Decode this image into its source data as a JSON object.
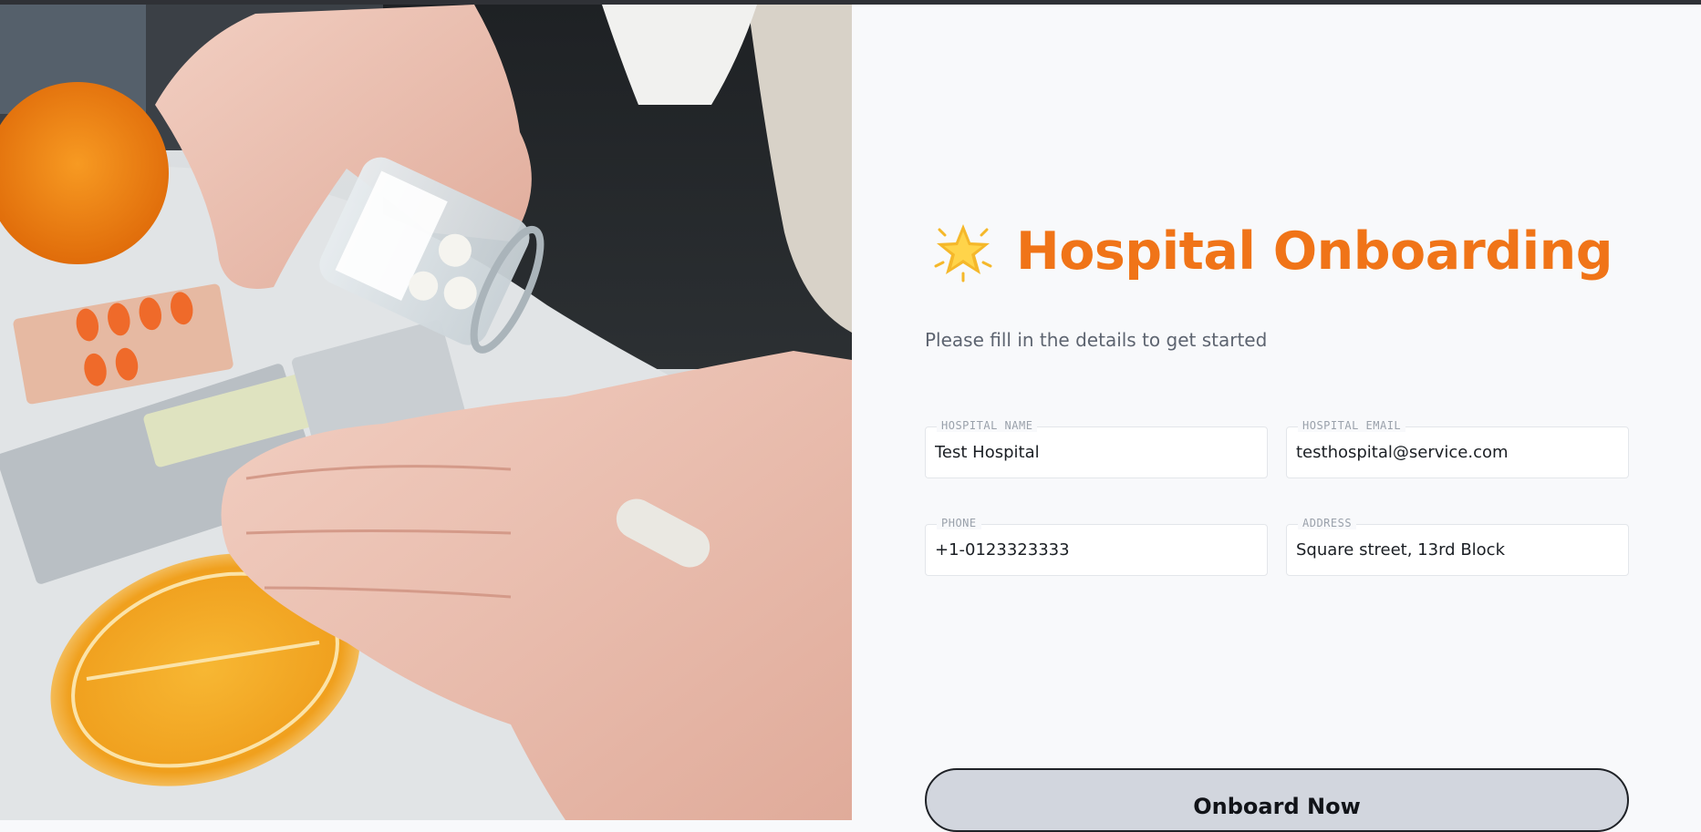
{
  "hero_image": {
    "icon": "pills-in-hand-photo"
  },
  "form": {
    "title": "Hospital Onboarding",
    "title_icon": "star-icon",
    "subtitle": "Please fill in the details to get started",
    "fields": {
      "hospital_name": {
        "label": "HOSPITAL NAME",
        "value": "Test Hospital"
      },
      "hospital_email": {
        "label": "HOSPITAL EMAIL",
        "value": "testhospital@service.com"
      },
      "phone": {
        "label": "PHONE",
        "value": "+1-0123323333"
      },
      "address": {
        "label": "ADDRESS",
        "value": "Square street, 13rd Block"
      }
    },
    "submit_label": "Onboard Now"
  },
  "colors": {
    "accent": "#f07418",
    "background": "#f8f9fb",
    "button_bg": "#d2d6de"
  }
}
